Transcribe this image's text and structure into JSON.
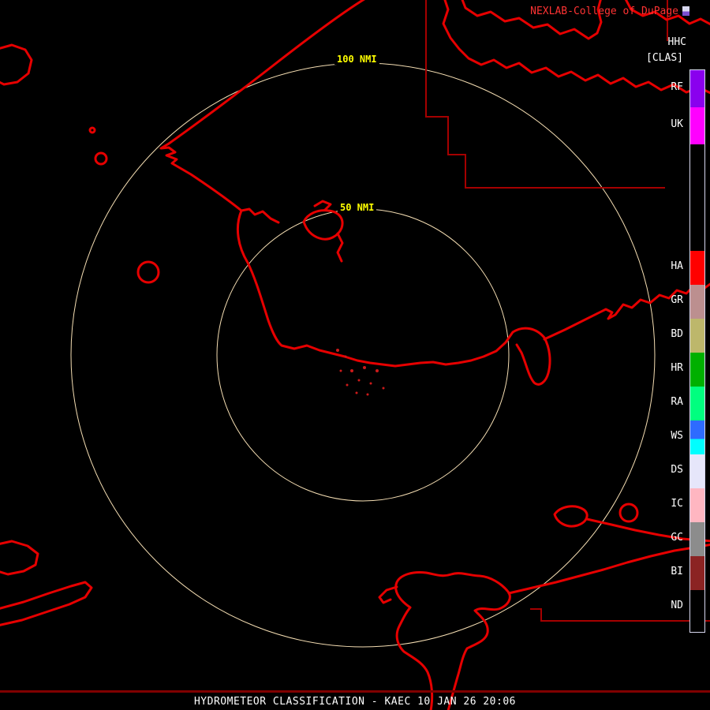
{
  "header": {
    "brand": "NEXLAB-College of DuPage",
    "product_code": "HHC",
    "product_mode": "[CLAS]"
  },
  "rings": [
    {
      "label": "100 NMI"
    },
    {
      "label": "50 NMI"
    }
  ],
  "legend": {
    "items": [
      {
        "code": "RF",
        "color": "#8a00ee"
      },
      {
        "code": "UK",
        "color": "#ff00ff"
      },
      {
        "code": "HA",
        "color": "#ff0000"
      },
      {
        "code": "GR",
        "color": "#bc8f8f"
      },
      {
        "code": "BD",
        "color": "#bdb76b"
      },
      {
        "code": "HR",
        "color": "#00b000"
      },
      {
        "code": "RA",
        "color": "#00ff7f"
      },
      {
        "code": "WS",
        "color": "linear-gradient(180deg,#2e6bff 0 55%,#00ffff 55%)"
      },
      {
        "code": "DS",
        "color": "#e6e6fa"
      },
      {
        "code": "IC",
        "color": "#ffb6c1"
      },
      {
        "code": "GC",
        "color": "#8c8c8c"
      },
      {
        "code": "BI",
        "color": "#8b2323"
      },
      {
        "code": "ND",
        "color": "#000000"
      }
    ]
  },
  "footer": {
    "title": "HYDROMETEOR CLASSIFICATION - KAEC 10 JAN 26 20:06"
  },
  "colors": {
    "background": "#000000",
    "coastline": "#e60000",
    "boundary": "#a50000",
    "ring": "#f5deb3",
    "ring_label": "#ffff00",
    "text": "#ffffff",
    "brand": "#ff3333",
    "footer_rule": "#800000",
    "legend_border": "#d8d8f0",
    "echo": "#cc1a1a"
  }
}
